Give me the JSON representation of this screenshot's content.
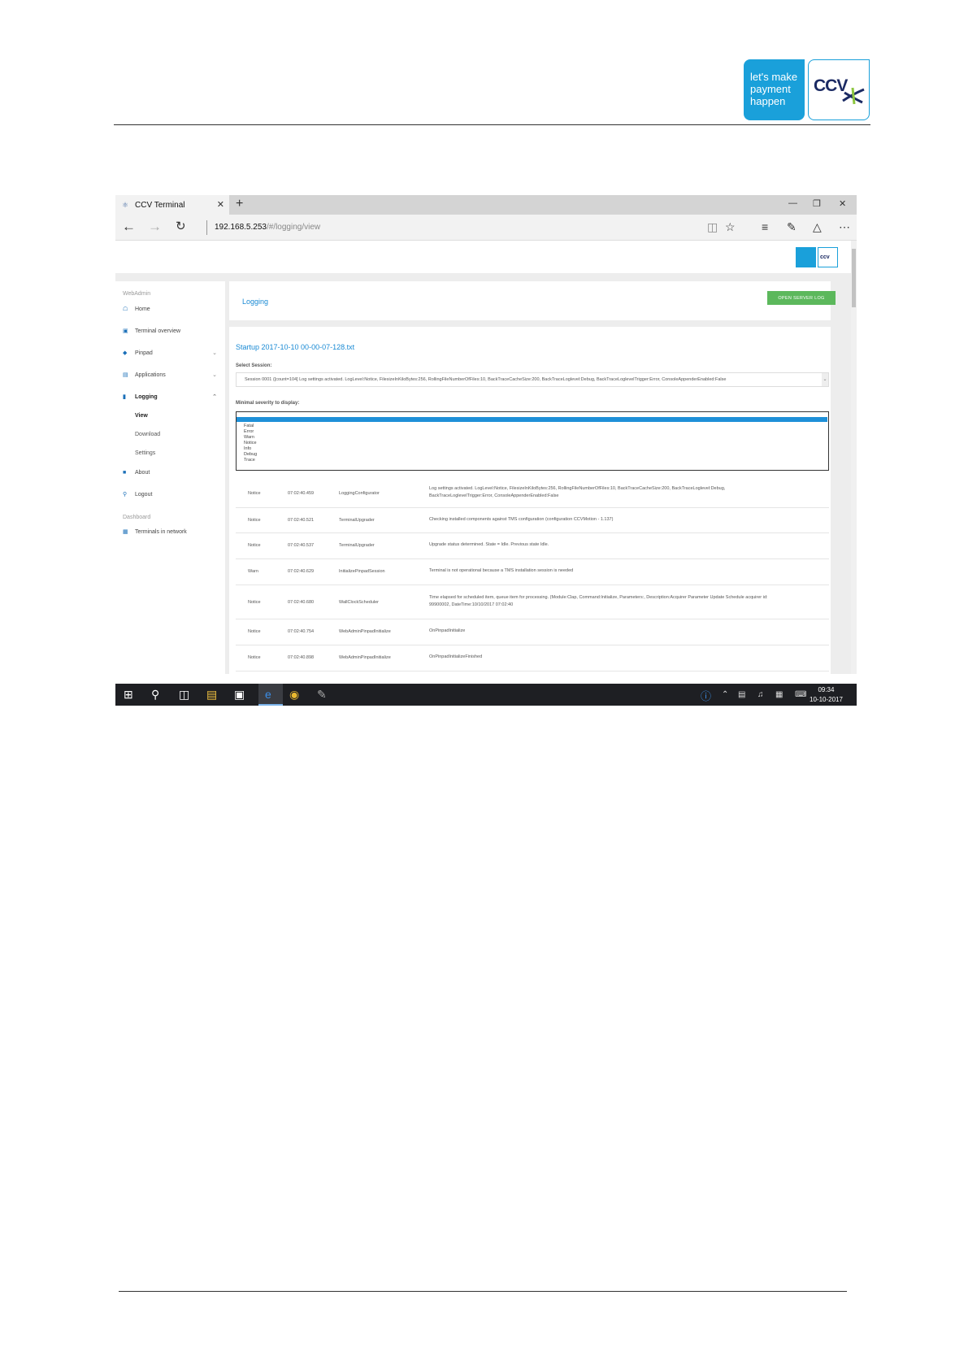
{
  "doc_logo": {
    "tagline_line1": "let's make",
    "tagline_line2": "payment",
    "tagline_line3": "happen",
    "brand": "CCV"
  },
  "browser": {
    "tab_title": "CCV Terminal",
    "url_host": "192.168.5.253",
    "url_path": "/#/logging/view"
  },
  "app": {
    "mini_logo_brand": "ccv"
  },
  "sidebar": {
    "section1": "WebAdmin",
    "items": [
      {
        "label": "Home"
      },
      {
        "label": "Terminal overview"
      },
      {
        "label": "Pinpad"
      },
      {
        "label": "Applications"
      },
      {
        "label": "Logging"
      },
      {
        "label": "View"
      },
      {
        "label": "Download"
      },
      {
        "label": "Settings"
      },
      {
        "label": "About"
      },
      {
        "label": "Logout"
      }
    ],
    "section2": "Dashboard",
    "dashboard_item": "Terminals in network"
  },
  "panel": {
    "title": "Logging",
    "open_log_button": "OPEN SERVER LOG",
    "file_title": "Startup 2017-10-10 00-00-07-128.txt",
    "select_session_label": "Select Session:",
    "session_value": "Session 0001 ([count=104] Log settings activated. LogLevel:Notice, FilesizeInKiloBytes:256, RollingFileNumberOfFiles:10, BackTraceCacheSize:200, BackTraceLoglevel:Debug, BackTraceLoglevelTrigger:Error, ConsoleAppenderEnabled:False",
    "severity_label": "Minimal severity to display:",
    "severity_options": [
      "Fatal",
      "Error",
      "Warn",
      "Notice",
      "Info",
      "Debug",
      "Trace"
    ]
  },
  "log_rows": [
    {
      "level": "Notice",
      "time": "07:02:40.459",
      "source": "LoggingConfigurator",
      "message": "Log settings activated. LogLevel:Notice, FilesizeInKiloBytes:256, RollingFileNumberOfFiles:10, BackTraceCacheSize:200, BackTraceLoglevel:Debug, BackTraceLoglevelTrigger:Error, ConsoleAppenderEnabled:False"
    },
    {
      "level": "Notice",
      "time": "07:02:40.521",
      "source": "TerminalUpgrader",
      "message": "Checking installed components against TMS configuration (configuration CCVMotion - 1.137)"
    },
    {
      "level": "Notice",
      "time": "07:02:40.537",
      "source": "TerminalUpgrader",
      "message": "Upgrade status determined. State = Idle. Previous state Idle."
    },
    {
      "level": "Warn",
      "time": "07:02:40.629",
      "source": "InitializePinpadSession",
      "message": "Terminal is not operational because a TMS installation session is needed"
    },
    {
      "level": "Notice",
      "time": "07:02:40.680",
      "source": "WallClockScheduler",
      "message": "Time elapsed for scheduled item, queue item for processing. (Module:Clap, Command:Initialize, Parameters:, Description:Acquirer Parameter Update Schedule acquirer id: 99900002, DateTime:10/10/2017 07:02:40"
    },
    {
      "level": "Notice",
      "time": "07:02:40.754",
      "source": "WebAdminPinpadInitialize",
      "message": "OnPinpadInitialize"
    },
    {
      "level": "Notice",
      "time": "07:02:40.898",
      "source": "WebAdminPinpadInitialize",
      "message": "OnPinpadInitializeFinished"
    }
  ],
  "taskbar": {
    "time": "09:34",
    "date": "10-10-2017"
  }
}
